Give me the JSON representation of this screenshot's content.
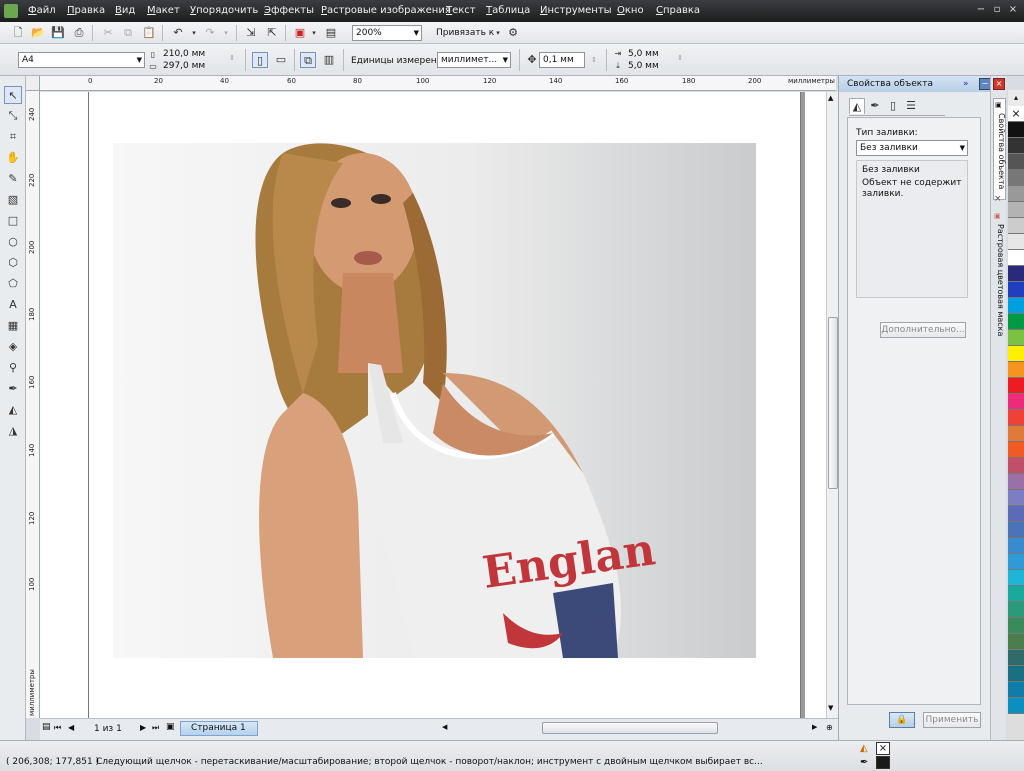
{
  "menu": [
    "Файл",
    "Правка",
    "Вид",
    "Макет",
    "Упорядочить",
    "Эффекты",
    "Растровые изображения",
    "Текст",
    "Таблица",
    "Инструменты",
    "Окно",
    "Справка"
  ],
  "toolbar": {
    "zoom_value": "200%",
    "snap_label": "Привязать к"
  },
  "propbar": {
    "page_size": "A4",
    "width": "210,0 мм",
    "height": "297,0 мм",
    "units_label": "Единицы измерения:",
    "units_value": "миллимет...",
    "nudge": "0,1 мм",
    "dup_x": "5,0 мм",
    "dup_y": "5,0 мм"
  },
  "ruler": {
    "h_labels": [
      "0",
      "20",
      "40",
      "60",
      "80",
      "100",
      "120",
      "140",
      "160",
      "180",
      "200"
    ],
    "h_unit": "миллиметры",
    "v_labels": [
      "240",
      "220",
      "200",
      "180",
      "160",
      "140",
      "120",
      "100"
    ],
    "v_unit": "миллиметры"
  },
  "page_nav": {
    "counter": "1 из 1",
    "page_tab": "Страница 1"
  },
  "docker": {
    "title": "Свойства объекта",
    "fill_type_label": "Тип заливки:",
    "fill_type_value": "Без заливки",
    "info_heading": "Без заливки",
    "info_text": "Объект не содержит заливки.",
    "advanced_button": "Дополнительно...",
    "apply_button": "Применить",
    "side_tab_1": "Свойства объекта",
    "side_tab_2": "Растровая цветовая маска"
  },
  "image": {
    "shirt_text": "Englan"
  },
  "palette": [
    "#ffffff",
    "#111111",
    "#333333",
    "#555555",
    "#777777",
    "#999999",
    "#b3b3b3",
    "#cccccc",
    "#e6e6e6",
    "#ffffff",
    "#2a2a7a",
    "#1f3fbf",
    "#00a0e0",
    "#009a44",
    "#7cc242",
    "#ffef00",
    "#f7941d",
    "#ec1c24",
    "#ee2a7b",
    "#ef4136",
    "#e07a3a",
    "#f15a24",
    "#c0506a",
    "#9b6fa8",
    "#7d7dc4",
    "#5b6bb5",
    "#4a73b8",
    "#3a8ad0",
    "#2e9bd6",
    "#1fb5d9",
    "#19a99d",
    "#2a9a7a",
    "#3a8a5a",
    "#4c7d4c",
    "#2f6b6b",
    "#1b6f83",
    "#0e7ea8",
    "#0c8fbf"
  ],
  "status": {
    "coords": "( 206,308; 177,851 )",
    "hint": "Следующий щелчок - перетаскивание/масштабирование; второй щелчок - поворот/наклон; инструмент с двойным щелчком выбирает вс..."
  }
}
